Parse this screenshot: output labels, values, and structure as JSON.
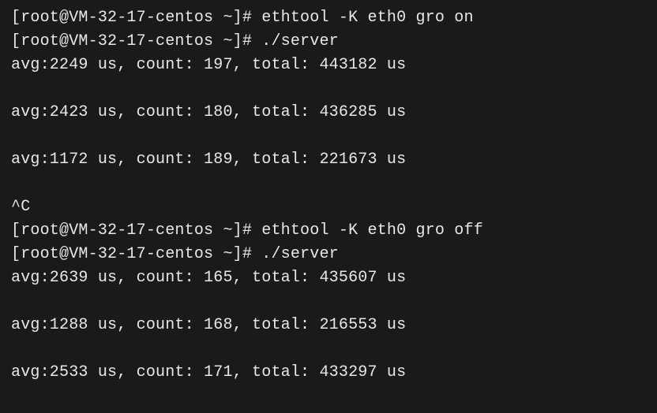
{
  "lines": [
    "[root@VM-32-17-centos ~]# ethtool -K eth0 gro on",
    "[root@VM-32-17-centos ~]# ./server",
    "avg:2249 us, count: 197, total: 443182 us",
    "",
    "avg:2423 us, count: 180, total: 436285 us",
    "",
    "avg:1172 us, count: 189, total: 221673 us",
    "",
    "^C",
    "[root@VM-32-17-centos ~]# ethtool -K eth0 gro off",
    "[root@VM-32-17-centos ~]# ./server",
    "avg:2639 us, count: 165, total: 435607 us",
    "",
    "avg:1288 us, count: 168, total: 216553 us",
    "",
    "avg:2533 us, count: 171, total: 433297 us"
  ]
}
